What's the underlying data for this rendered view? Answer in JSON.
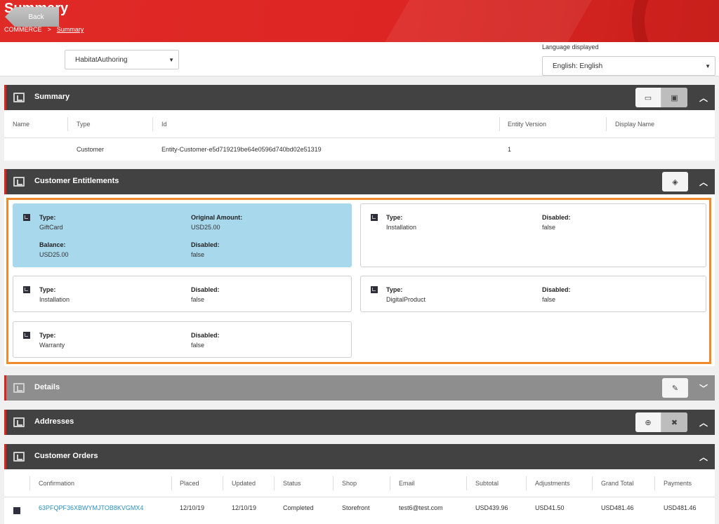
{
  "header": {
    "title": "Summary",
    "breadcrumb": {
      "root": "COMMERCE",
      "separator": ">",
      "current": "Summary"
    }
  },
  "toolbar": {
    "back_label": "Back",
    "environment_select": "HabitatAuthoring",
    "language_label": "Language displayed",
    "language_select": "English: English"
  },
  "summary": {
    "title": "Summary",
    "columns": [
      "Name",
      "Type",
      "Id",
      "Entity Version",
      "Display Name"
    ],
    "row": {
      "name": "",
      "type": "Customer",
      "id": "Entity-Customer-e5d719219be64e0596d740bd02e51319",
      "version": "1",
      "display_name": ""
    }
  },
  "entitlements": {
    "title": "Customer Entitlements",
    "labels": {
      "type": "Type:",
      "original_amount": "Original Amount:",
      "balance": "Balance:",
      "disabled": "Disabled:"
    },
    "cards": [
      {
        "type": "GiftCard",
        "original_amount": "USD25.00",
        "balance": "USD25.00",
        "disabled": "false"
      },
      {
        "type": "Installation",
        "disabled": "false"
      },
      {
        "type": "Installation",
        "disabled": "false"
      },
      {
        "type": "DigitalProduct",
        "disabled": "false"
      },
      {
        "type": "Warranty",
        "disabled": "false"
      }
    ]
  },
  "details": {
    "title": "Details"
  },
  "addresses": {
    "title": "Addresses"
  },
  "orders": {
    "title": "Customer Orders",
    "columns": [
      "Confirmation",
      "Placed",
      "Updated",
      "Status",
      "Shop",
      "Email",
      "Subtotal",
      "Adjustments",
      "Grand Total",
      "Payments"
    ],
    "rows": [
      {
        "confirmation": "63PFQPF36XBWYMJTOB8KVGMX4",
        "placed": "12/10/19",
        "updated": "12/10/19",
        "status": "Completed",
        "shop": "Storefront",
        "email": "test6@test.com",
        "subtotal": "USD439.96",
        "adjustments": "USD41.50",
        "grand_total": "USD481.46",
        "payments": "USD481.46"
      }
    ]
  },
  "icons": {
    "panel": "panel-icon",
    "calendar": "calendar-icon",
    "archive": "archive-icon",
    "tag": "tag-icon",
    "edit": "edit-icon",
    "add": "add-circle-icon",
    "remove": "remove-icon",
    "chevron_up": "chevron-up-icon",
    "chevron_down": "chevron-down-icon"
  },
  "colors": {
    "brand_red": "#dd2623",
    "panel_dark": "#424242",
    "panel_grey": "#8e8e8e",
    "highlight": "#f08a2b",
    "selected_card": "#a8d8ec",
    "link": "#2a8fbd"
  }
}
